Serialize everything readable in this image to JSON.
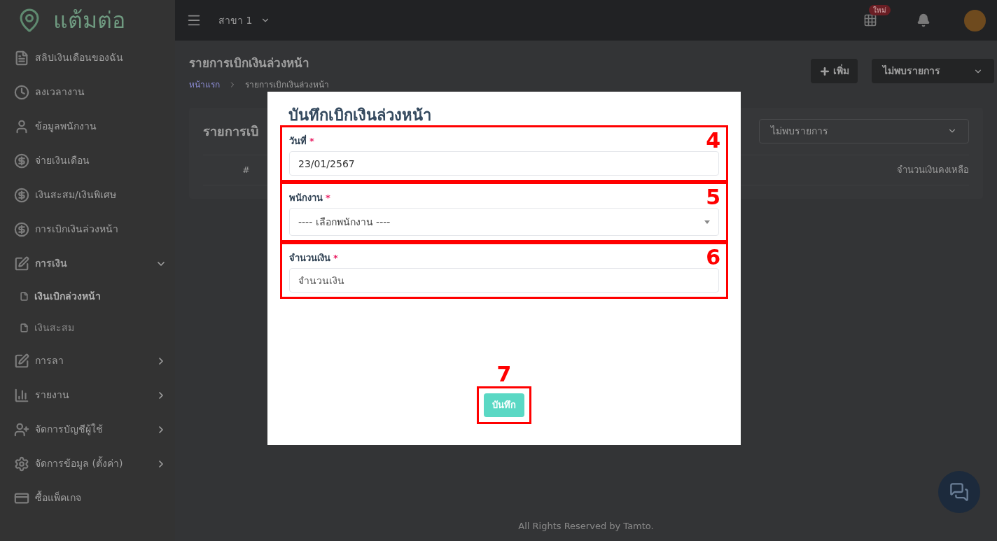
{
  "logo": {
    "text": "แต้มต่อ"
  },
  "sidebar": {
    "items": [
      {
        "label": "สลิปเงินเดือนของฉัน",
        "kind": "document"
      },
      {
        "label": "ลงเวลางาน",
        "kind": "clock"
      },
      {
        "label": "ข้อมูลพนักงาน",
        "kind": "user"
      },
      {
        "label": "จ่ายเงินเดือน",
        "kind": "money"
      },
      {
        "label": "เงินสะสม/เงินพิเศษ",
        "kind": "money"
      },
      {
        "label": "การเบิกเงินล่วงหน้า",
        "kind": "money"
      },
      {
        "label": "การเงิน",
        "kind": "edit",
        "expanded": true,
        "children": [
          {
            "label": "เงินเบิกล่วงหน้า",
            "selected": true
          },
          {
            "label": "เงินสะสม",
            "selected": false
          }
        ]
      },
      {
        "label": "การลา",
        "kind": "edit",
        "expanded": false
      },
      {
        "label": "รายงาน",
        "kind": "chart",
        "expanded": false
      },
      {
        "label": "จัดการบัญชีผู้ใช้",
        "kind": "user-plus",
        "expanded": false
      },
      {
        "label": "จัดการข้อมูล (ตั้งค่า)",
        "kind": "gears",
        "expanded": false
      },
      {
        "label": "ซื้อแพ็คเกจ",
        "kind": "card"
      }
    ]
  },
  "top_bar": {
    "branch": "สาขา 1",
    "apps_badge": "ใหม่"
  },
  "page_header": {
    "title": "รายการเบิกเงินล่วงหน้า",
    "breadcrumb": [
      "หน้าแรก",
      "รายการเบิกเงินล่วงหน้า"
    ],
    "add_button": "เพิ่ม",
    "select": "ไม่พบรายการ"
  },
  "card": {
    "title": "รายการเบิ",
    "filter": "ไม่พบรายการ",
    "table": {
      "columns": [
        "#",
        "จำนวนเงินคงเหลือ"
      ]
    }
  },
  "modal": {
    "title": "บันทึกเบิกเงินล่วงหน้า",
    "fields": [
      {
        "label": "วันที่",
        "required_mark": "*",
        "kind": "text",
        "value": "23/01/2567",
        "annotation": "4"
      },
      {
        "label": "พนักงาน",
        "required_mark": "*",
        "kind": "select",
        "value": "---- เลือกพนักงาน ----",
        "annotation": "5"
      },
      {
        "label": "จำนวนเงิน",
        "required_mark": "*",
        "kind": "text",
        "placeholder": "จำนวนเงิน",
        "annotation": "6"
      }
    ],
    "submit": {
      "label": "บันทึก",
      "annotation": "7"
    }
  },
  "footer": "All Rights Reserved by Tamto."
}
